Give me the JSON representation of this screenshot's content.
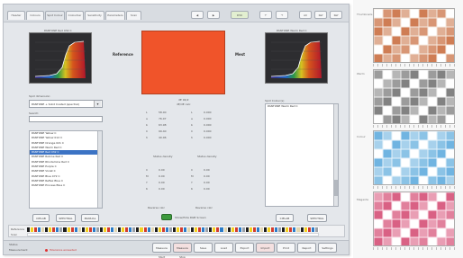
{
  "tabs": [
    "Header",
    "Colours",
    "Spot Colour",
    "Colourbar",
    "Sensitivity",
    "Parameters",
    "Scan"
  ],
  "toolbar": {
    "left_buttons": [
      "",
      ""
    ],
    "center_button": "D50",
    "right_buttons": [
      "",
      "",
      "All",
      "Ref",
      "Ref"
    ]
  },
  "left_panel": {
    "spectrum_title": "PANTONE Red 032 C",
    "dropdown_label": "Spot dimension:",
    "dropdown_value": "PANTONE + Solid Coated (spectral)",
    "search_label": "Search:",
    "list_items": [
      "PANTONE Yellow C",
      "PANTONE Yellow 012 C",
      "PANTONE Orange 021 C",
      "PANTONE Warm Red C",
      "PANTONE Red 032 C",
      "PANTONE Rubine Red C",
      "PANTONE Rhodamine Red C",
      "PANTONE Purple C",
      "PANTONE Violet C",
      "PANTONE Blue 072 C",
      "PANTONE Reflex Blue C",
      "PANTONE Process Blue C"
    ],
    "selected_index": 4,
    "buttons": [
      "CIELAB",
      "SPECTRAL",
      "MANUAL"
    ]
  },
  "center": {
    "reference_label": "Reference",
    "sample_label": "Mest",
    "swatch_color": "#f0542a",
    "delta_header": "dE 94/2",
    "delta_sub": "dE/dE calc",
    "values_rows": [
      [
        "L",
        "58.00",
        "L",
        "0.000"
      ],
      [
        "a",
        "76.07",
        "a",
        "0.000"
      ],
      [
        "b",
        "63.98",
        "b",
        "0.000"
      ],
      [
        "C",
        "99.40",
        "C",
        "0.000"
      ],
      [
        "h",
        "40.06",
        "h",
        "0.000"
      ]
    ],
    "density_labels": [
      "Status density",
      "Status density"
    ],
    "density_rows": [
      [
        "C",
        "0.00",
        "C",
        "0.00"
      ],
      [
        "M",
        "0.00",
        "M",
        "0.00"
      ],
      [
        "Y",
        "0.00",
        "Y",
        "0.00"
      ],
      [
        "K",
        "0.00",
        "K",
        "0.00"
      ]
    ],
    "bottom_labels": [
      "Reverse calc",
      "Reverse calc"
    ],
    "toggle_label": "Show/Hide RGB Screen"
  },
  "right_panel": {
    "spectrum_title": "PANTONE Warm Red C",
    "list_label": "Spot Colour(s)",
    "list_items": [
      "PANTONE Warm Red C"
    ],
    "buttons": [
      "CIELAB",
      "SPECTRAL"
    ]
  },
  "colorbar": {
    "label_top": "Reference",
    "label_bottom": "Scan",
    "patches": [
      "#1c1c1c",
      "#f3d11e",
      "#d23b2f",
      "#2b7bc8",
      "#e2d6b0",
      "#1c1c1c",
      "#f3d11e",
      "#d23b2f",
      "#2b7bc8",
      "#9aa0a8",
      "#1c1c1c",
      "#f3d11e",
      "#d23b2f",
      "#2b7bc8",
      "#e2d6b0",
      "#1c1c1c",
      "#f3d11e",
      "#d23b2f",
      "#2b7bc8",
      "#9aa0a8",
      "#1c1c1c",
      "#f3d11e",
      "#d23b2f",
      "#2b7bc8",
      "#e2d6b0",
      "#1c1c1c",
      "#f3d11e",
      "#d23b2f",
      "#2b7bc8",
      "#9aa0a8",
      "#1c1c1c",
      "#f3d11e",
      "#d23b2f",
      "#2b7bc8",
      "#e2d6b0",
      "#1c1c1c",
      "#f3d11e",
      "#d23b2f",
      "#2b7bc8",
      "#9aa0a8",
      "#1c1c1c",
      "#f3d11e",
      "#d23b2f",
      "#2b7bc8",
      "#e2d6b0",
      "#1c1c1c",
      "#f3d11e",
      "#d23b2f",
      "#2b7bc8",
      "#9aa0a8",
      "#1c1c1c",
      "#f3d11e",
      "#d23b2f",
      "#2b7bc8",
      "#e2d6b0",
      "#1c1c1c",
      "#f3d11e",
      "#d23b2f",
      "#2b7bc8",
      "#9aa0a8",
      "#1c1c1c",
      "#f3d11e",
      "#d23b2f",
      "#2b7bc8",
      "#e2d6b0",
      "#1c1c1c",
      "#f3d11e",
      "#d23b2f",
      "#2b7bc8",
      "#9aa0a8",
      "#1c1c1c",
      "#f3d11e",
      "#d23b2f",
      "#2b7bc8",
      "#e2d6b0",
      "#1c1c1c",
      "#f3d11e",
      "#d23b2f",
      "#2b7bc8",
      "#9aa0a8"
    ]
  },
  "bottom_bar": {
    "left_text": "Status",
    "left_sub": "Measurement",
    "legend_text": "Tolerance exceeded",
    "buttons": [
      "Measure Start",
      "Measure Stop",
      "Save",
      "Load",
      "Export",
      "Import",
      "Print",
      "Report",
      "Settings"
    ]
  },
  "sidebar": {
    "title": "Thumbnails",
    "labels": [
      "Warm",
      "Colour",
      "Cyan",
      "Magenta"
    ],
    "images": [
      {
        "tone": "#c86a3c",
        "bg": "#f5e8df"
      },
      {
        "tone": "#6f6f6f",
        "bg": "#f1f1f1"
      },
      {
        "tone": "#5aa9dc",
        "bg": "#e6f2fa"
      },
      {
        "tone": "#d24a72",
        "bg": "#fbe4ec"
      }
    ]
  }
}
